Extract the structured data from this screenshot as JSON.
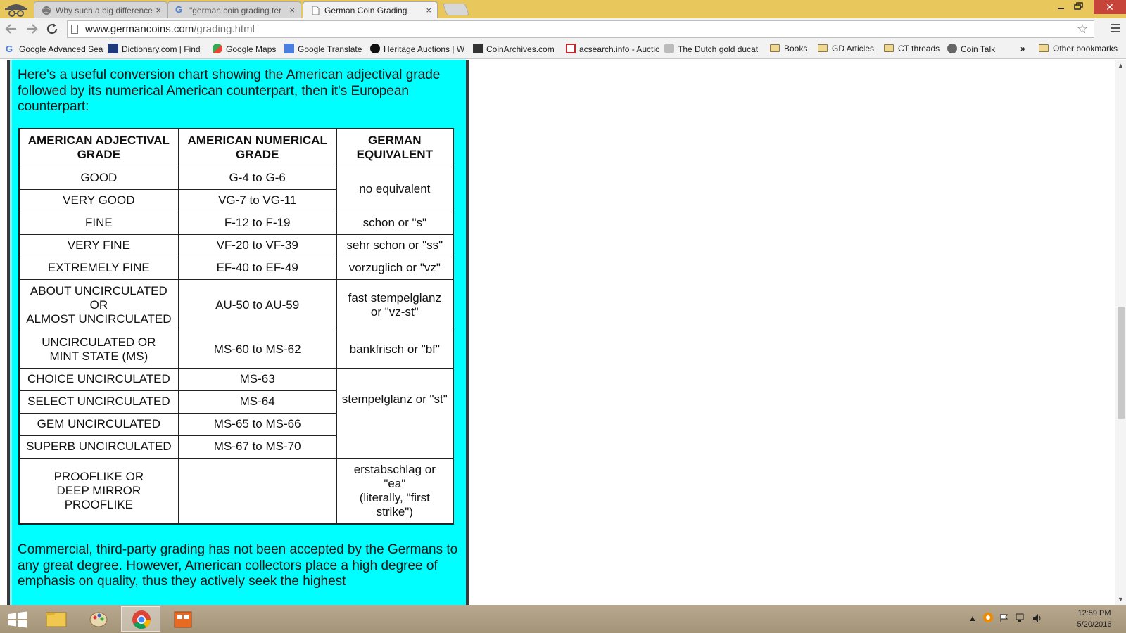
{
  "browser": {
    "tabs": [
      {
        "label": "Why such a big difference",
        "close": "×"
      },
      {
        "label": "\"german coin grading ter",
        "close": "×"
      },
      {
        "label": "German Coin Grading",
        "close": "×"
      }
    ],
    "url_host": "www.germancoins.com",
    "url_path": "/grading.html",
    "bookmarks": [
      {
        "label": "Google Advanced Sea"
      },
      {
        "label": "Dictionary.com | Find"
      },
      {
        "label": "Google Maps"
      },
      {
        "label": "Google Translate"
      },
      {
        "label": "Heritage Auctions | W"
      },
      {
        "label": "CoinArchives.com"
      },
      {
        "label": "acsearch.info - Auctio"
      },
      {
        "label": "The Dutch gold ducat"
      },
      {
        "label": "Books"
      },
      {
        "label": "GD Articles"
      },
      {
        "label": "CT threads"
      },
      {
        "label": "Coin Talk"
      },
      {
        "label": "Other bookmarks"
      }
    ],
    "more_bookmarks": "»"
  },
  "page": {
    "intro": "Here's a useful conversion chart showing the American adjectival grade followed by its numerical American counterpart, then it's European counterpart:",
    "table": {
      "headers": [
        "AMERICAN ADJECTIVAL GRADE",
        "AMERICAN NUMERICAL GRADE",
        "GERMAN EQUIVALENT"
      ],
      "rows": [
        {
          "adjectival": "GOOD",
          "numerical": "G-4 to G-6"
        },
        {
          "adjectival": "VERY GOOD",
          "numerical": "VG-7 to VG-11"
        },
        {
          "adjectival": "FINE",
          "numerical": "F-12 to F-19"
        },
        {
          "adjectival": "VERY FINE",
          "numerical": "VF-20 to VF-39"
        },
        {
          "adjectival": "EXTREMELY FINE",
          "numerical": "EF-40 to EF-49"
        },
        {
          "adjectival_lines": [
            "ABOUT UNCIRCULATED",
            "OR",
            "ALMOST UNCIRCULATED"
          ],
          "numerical": "AU-50 to AU-59"
        },
        {
          "adjectival_lines": [
            "UNCIRCULATED OR",
            "MINT STATE (MS)"
          ],
          "numerical": "MS-60 to MS-62"
        },
        {
          "adjectival": "CHOICE UNCIRCULATED",
          "numerical": "MS-63"
        },
        {
          "adjectival": "SELECT UNCIRCULATED",
          "numerical": "MS-64"
        },
        {
          "adjectival": "GEM UNCIRCULATED",
          "numerical": "MS-65 to MS-66"
        },
        {
          "adjectival": "SUPERB UNCIRCULATED",
          "numerical": "MS-67 to MS-70"
        },
        {
          "adjectival_lines": [
            "PROOFLIKE OR",
            "DEEP MIRROR",
            "PROOFLIKE"
          ],
          "numerical": ""
        }
      ],
      "german": {
        "no_equivalent": "no equivalent",
        "schon": "schon or \"s\"",
        "sehr_schon": "sehr schon or \"ss\"",
        "vorzuglich": "vorzuglich or \"vz\"",
        "fast_stempelglanz_lines": [
          "fast stempelglanz",
          "or \"vz-st\""
        ],
        "bankfrisch": "bankfrisch or \"bf\"",
        "stempelglanz": "stempelglanz or \"st\"",
        "erstabschlag_lines": [
          "erstabschlag or",
          "\"ea\"",
          "(literally, \"first",
          "strike\")"
        ]
      }
    },
    "outro": "Commercial, third-party grading has not been accepted by the Germans to any great degree. However, American collectors place a high degree of emphasis on quality, thus they actively seek the highest"
  },
  "taskbar": {
    "time": "12:59 PM",
    "date": "5/20/2016",
    "tray_expand": "▲"
  },
  "colors": {
    "panel_bg": "#00ffff",
    "titlebar": "#e8c75c"
  }
}
